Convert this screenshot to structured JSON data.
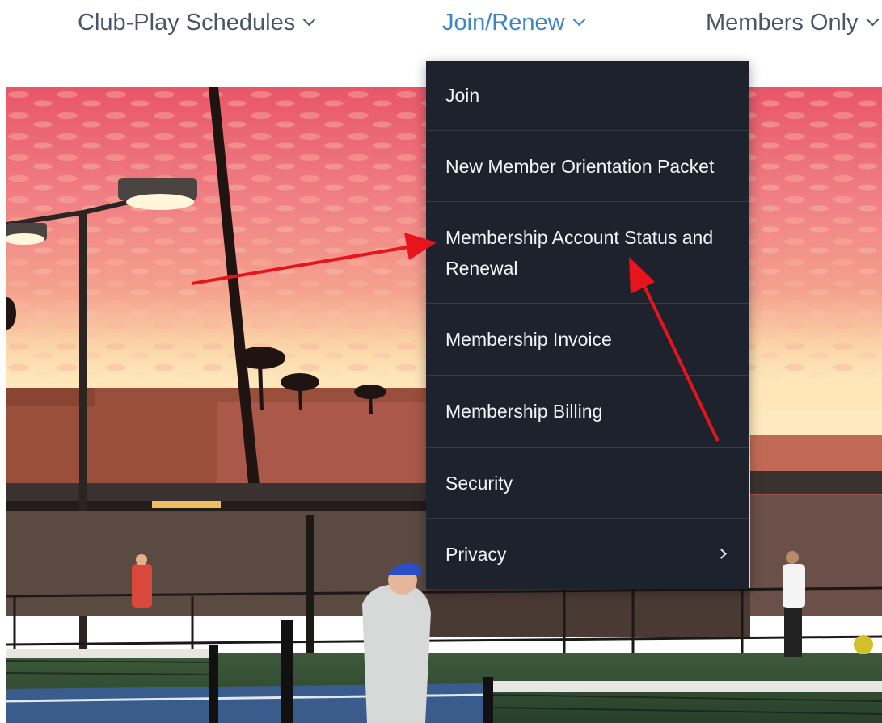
{
  "nav": {
    "items": [
      {
        "label": "Club-Play Schedules",
        "icon": "chevron-down-icon"
      },
      {
        "label": "Join/Renew",
        "icon": "chevron-down-icon",
        "active": true
      },
      {
        "label": "Members Only",
        "icon": "chevron-down-icon"
      }
    ],
    "colors": {
      "text": "#4a5568",
      "active": "#3d84c6"
    }
  },
  "dropdown": {
    "background": "#1d222d",
    "items": [
      {
        "label": "Join"
      },
      {
        "label": "New Member Orientation Packet"
      },
      {
        "label": "Membership Account Status and Renewal"
      },
      {
        "label": "Membership Invoice"
      },
      {
        "label": "Membership Billing"
      },
      {
        "label": "Security"
      },
      {
        "label": "Privacy",
        "icon": "chevron-right-icon"
      }
    ]
  },
  "annotation": {
    "arrow_color": "#e8141c"
  }
}
